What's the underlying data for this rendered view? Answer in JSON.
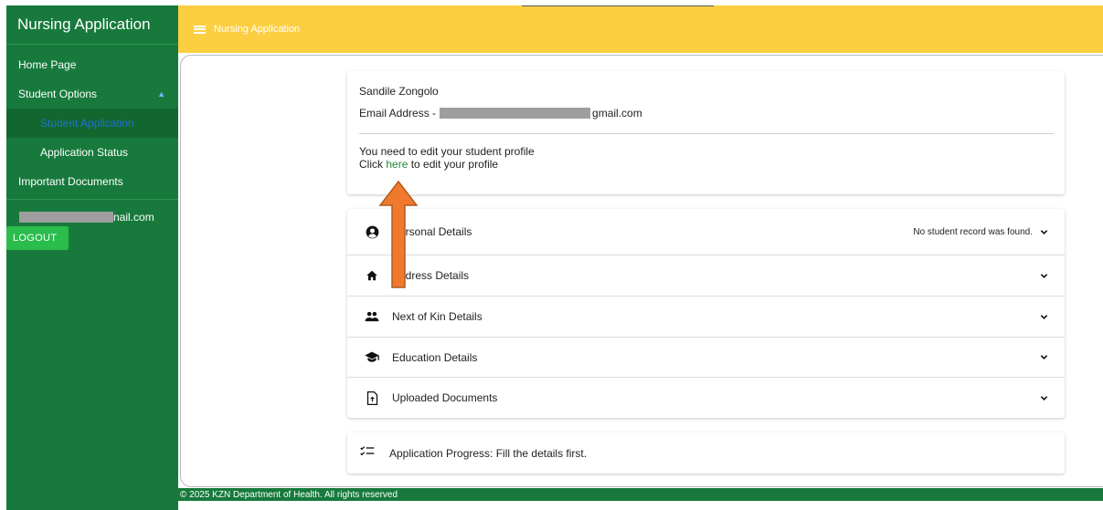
{
  "app": {
    "title": "Nursing Application"
  },
  "topbar": {
    "title": "Nursing Application"
  },
  "sidebar": {
    "items": [
      {
        "label": "Home Page"
      },
      {
        "label": "Student Options"
      },
      {
        "label": "Student Application"
      },
      {
        "label": "Application Status"
      },
      {
        "label": "Important Documents"
      }
    ],
    "email_suffix": "nail.com",
    "logout_label": "LOGOUT"
  },
  "profile": {
    "name": "Sandile Zongolo",
    "email_prefix": "Email Address -",
    "email_suffix": "gmail.com",
    "notice": "You need to edit your student profile",
    "click_pre": "Click",
    "link_label": "here",
    "click_post": "to edit your profile"
  },
  "sections": [
    {
      "label": "Personal Details",
      "icon": "account-circle-icon",
      "note": "No student record was found."
    },
    {
      "label": "Address Details",
      "icon": "home-icon"
    },
    {
      "label": "Next of Kin Details",
      "icon": "people-icon"
    },
    {
      "label": "Education Details",
      "icon": "graduation-cap-icon"
    },
    {
      "label": "Uploaded Documents",
      "icon": "upload-file-icon"
    }
  ],
  "progress": {
    "text": "Application Progress: Fill the details first.",
    "icon": "checklist-icon"
  },
  "footer": {
    "text": "© 2025 KZN Department of Health. All rights reserved"
  },
  "colors": {
    "sidebar": "#177a3c",
    "topbar": "#fccf42",
    "active_text": "#1e6fd8",
    "link": "#1f8a36",
    "logout": "#2bbd4c",
    "arrow": "#ef7a2e"
  }
}
